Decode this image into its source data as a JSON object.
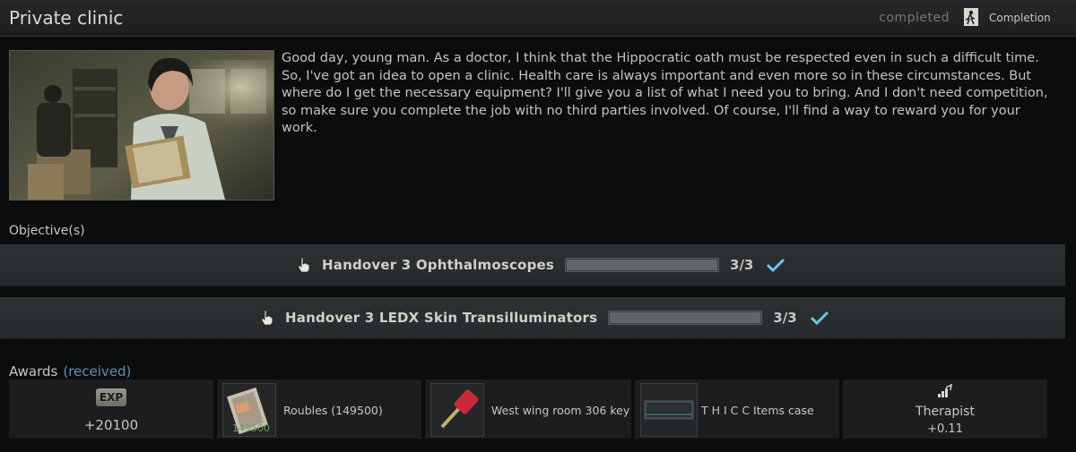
{
  "header": {
    "title": "Private clinic",
    "status": "completed",
    "completion_label": "Completion"
  },
  "quest": {
    "portrait_icon": "doctor-portrait",
    "description": "Good day, young man. As a doctor, I think that the Hippocratic oath must be respected even in such a difficult time. So, I've got an idea to open a clinic. Health care is always important and even more so in these circumstances. But where do I get the necessary equipment?  I'll give you a list of what I need you to bring. And I don't need competition, so make sure you complete the job with no third parties involved. Of course, I'll find a way to reward you for your work."
  },
  "objectives": {
    "heading": "Objective(s)",
    "items": [
      {
        "text": "Handover 3 Ophthalmoscopes",
        "count": "3/3",
        "progress": 1.0,
        "icon": "hand-pointer-icon",
        "status_icon": "check-icon"
      },
      {
        "text": "Handover 3 LEDX Skin Transilluminators",
        "count": "3/3",
        "progress": 1.0,
        "icon": "hand-pointer-icon",
        "status_icon": "check-icon"
      }
    ]
  },
  "awards": {
    "heading": "Awards",
    "received_label": "(received)",
    "exp_badge": "EXP",
    "exp_value": "+20100",
    "roubles_label": "Roubles (149500)",
    "roubles_amount": "149500",
    "key_label": "West wing room 306 key",
    "case_label": "T H I C C Items case",
    "trader_name": "Therapist",
    "trader_rep": "+0.11"
  },
  "colors": {
    "accent_blue": "#5b93b8",
    "check_color": "#6ec3e8",
    "roubles_green": "#6fa35c",
    "key_red": "#c8283a"
  }
}
